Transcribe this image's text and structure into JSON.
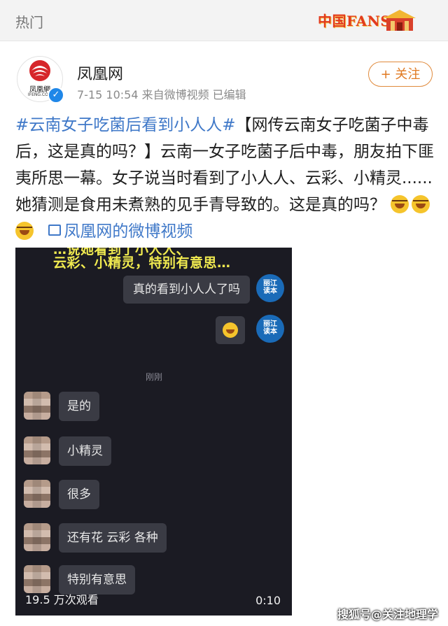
{
  "topbar": {
    "title": "热门",
    "badge_text": "中国FANS"
  },
  "post": {
    "author": {
      "name": "凤凰网",
      "avatar_text": "凤凰網",
      "avatar_sub": "IFENG.COM",
      "verified_icon": "✓"
    },
    "meta": "7-15 10:54  来自微博视频  已编辑",
    "follow_label": "+ 关注",
    "text": {
      "hashtag": "#云南女子吃菌后看到小人人#",
      "body": "【网传云南女子吃菌子中毒后，这是真的吗？】云南一女子吃菌子后中毒，朋友拍下匪夷所思一幕。女子说当时看到了小人人、云彩、小精灵......她猜测是食用未煮熟的见手青导致的。这是真的吗？",
      "video_link": "凤凰网的微博视频"
    }
  },
  "video": {
    "caption_line1": "…说她看到了小人人、",
    "caption_line2": "云彩、小精灵，特别有意思…",
    "messages_right": [
      {
        "text": "真的看到小人人了吗",
        "badge": "丽江\n读本"
      },
      {
        "text": "",
        "badge": "丽江\n读本"
      }
    ],
    "time_label": "刚刚",
    "messages_left": [
      "是的",
      "小精灵",
      "很多",
      "还有花 云彩 各种",
      "特别有意思"
    ],
    "views": "19.5 万次观看",
    "duration": "0:10"
  },
  "watermark": "搜狐号@关注地理学",
  "colors": {
    "link": "#3f78c8",
    "follow": "#e07a22",
    "caption": "#f0ea50",
    "video_bg": "#1b1b23"
  }
}
